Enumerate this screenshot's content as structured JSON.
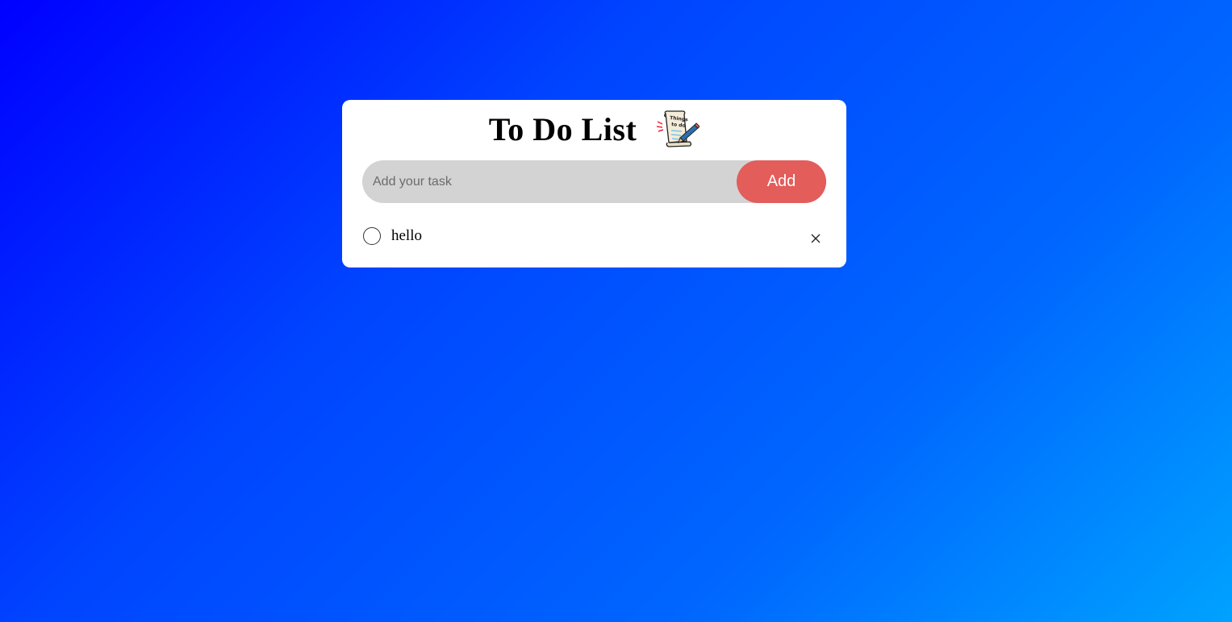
{
  "app": {
    "title": "To Do List",
    "title_icon": "things-to-do-scroll-icon"
  },
  "input": {
    "placeholder": "Add your task",
    "value": ""
  },
  "add_button": {
    "label": "Add"
  },
  "tasks": [
    {
      "text": "hello",
      "completed": false
    }
  ],
  "colors": {
    "add_button": "#e35d5b",
    "input_bg": "#d3d3d3",
    "gradient_start": "#0000ff",
    "gradient_end": "#00a2ff"
  }
}
